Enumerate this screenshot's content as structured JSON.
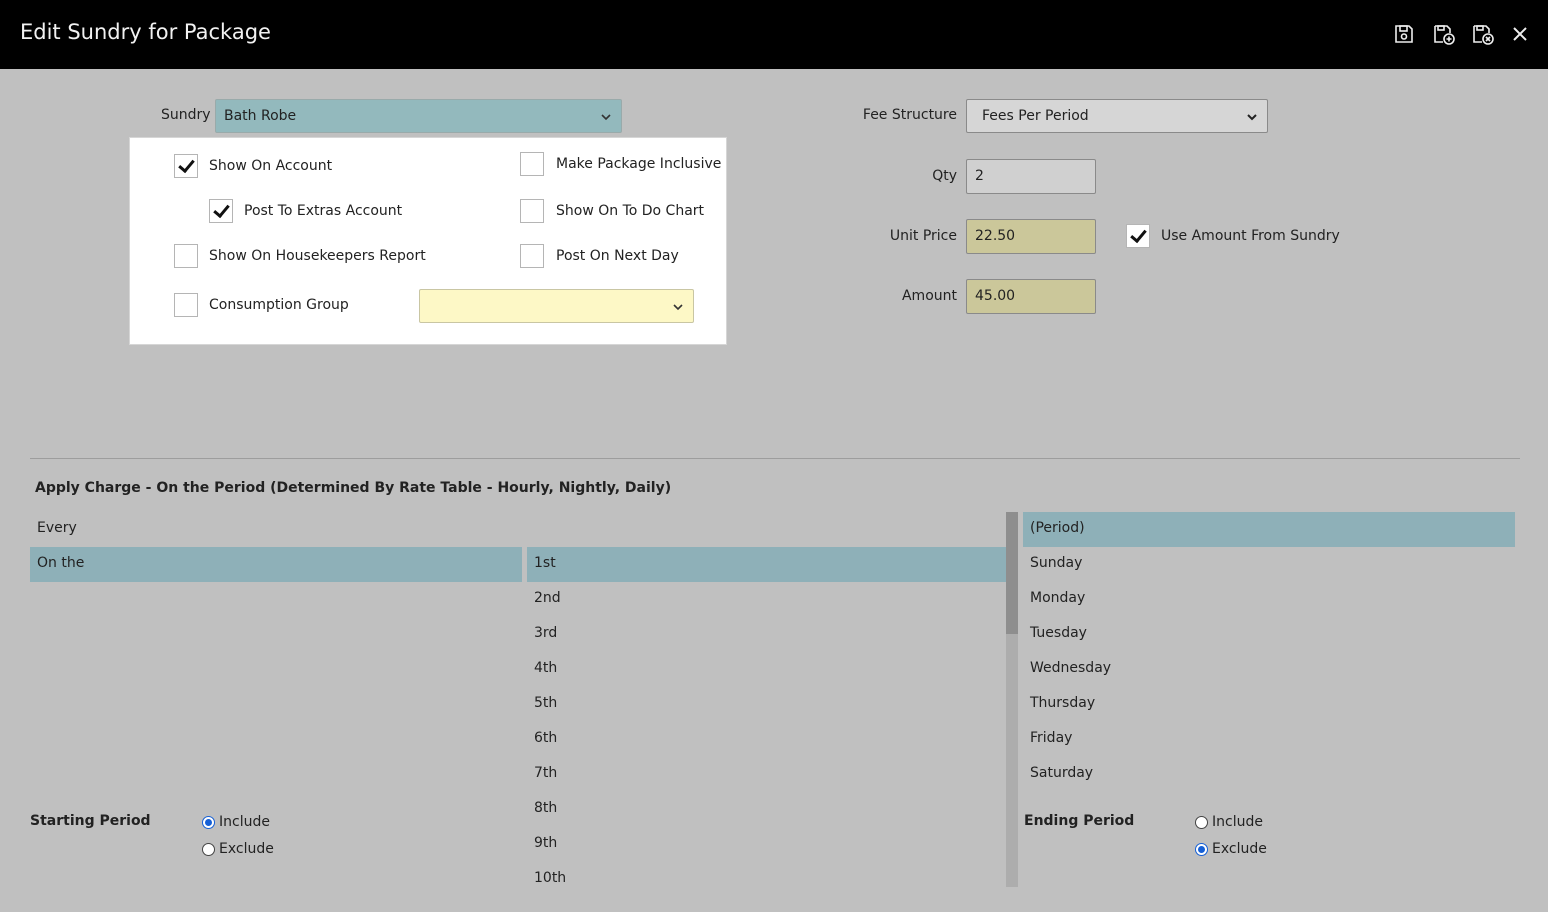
{
  "window": {
    "title": "Edit Sundry for Package"
  },
  "toolbar": {
    "icons": [
      "save-icon",
      "save-and-new-icon",
      "save-and-close-icon",
      "close-icon"
    ]
  },
  "form": {
    "sundry_label": "Sundry",
    "sundry_value": "Bath Robe",
    "options": {
      "show_on_account": {
        "label": "Show On Account",
        "checked": true
      },
      "post_to_extras": {
        "label": "Post To Extras Account",
        "checked": true
      },
      "show_on_housekeepers": {
        "label": "Show On Housekeepers Report",
        "checked": false
      },
      "consumption_group": {
        "label": "Consumption Group",
        "checked": false,
        "value": ""
      },
      "make_package_inclusive": {
        "label": "Make Package Inclusive",
        "checked": false
      },
      "show_on_todo": {
        "label": "Show On To Do Chart",
        "checked": false
      },
      "post_next_day": {
        "label": "Post On Next Day",
        "checked": false
      }
    },
    "fee_structure_label": "Fee Structure",
    "fee_structure_value": "Fees Per Period",
    "qty_label": "Qty",
    "qty_value": "2",
    "unit_price_label": "Unit Price",
    "unit_price_value": "22.50",
    "use_amount_label": "Use Amount From Sundry",
    "use_amount_checked": true,
    "amount_label": "Amount",
    "amount_value": "45.00"
  },
  "apply_charge": {
    "title": "Apply Charge - On the Period (Determined By Rate Table - Hourly, Nightly, Daily)",
    "mode_list": [
      "Every",
      "On the"
    ],
    "mode_selected": "On the",
    "ordinal_list": [
      "1st",
      "2nd",
      "3rd",
      "4th",
      "5th",
      "6th",
      "7th",
      "8th",
      "9th",
      "10th"
    ],
    "ordinal_selected": "1st",
    "day_list": [
      "(Period)",
      "Sunday",
      "Monday",
      "Tuesday",
      "Wednesday",
      "Thursday",
      "Friday",
      "Saturday"
    ],
    "day_selected": "(Period)"
  },
  "starting_period": {
    "label": "Starting Period",
    "include_label": "Include",
    "exclude_label": "Exclude",
    "selected": "Include"
  },
  "ending_period": {
    "label": "Ending Period",
    "include_label": "Include",
    "exclude_label": "Exclude",
    "selected": "Exclude"
  },
  "colors": {
    "titlebar": "#000000",
    "background": "#c0c0c0",
    "selection": "#8eb0b8",
    "sundry_select": "#93b9bd",
    "consumption_select": "#fdf8c6",
    "tan_input": "#cbc79a",
    "radio_accent": "#1660d6"
  }
}
